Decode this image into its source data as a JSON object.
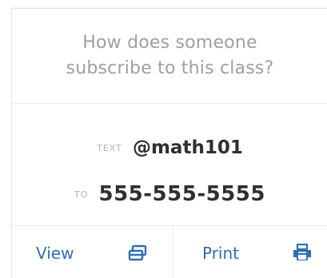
{
  "prompt": {
    "question": "How does someone subscribe to this class?"
  },
  "subscribe": {
    "text_label": "TEXT",
    "handle": "@math101",
    "to_label": "TO",
    "phone_number": "555-555-5555"
  },
  "actions": {
    "view_label": "View",
    "view_icon": "window-icon",
    "print_label": "Print",
    "print_icon": "printer-icon"
  },
  "colors": {
    "accent": "#2f6fb3",
    "muted_text": "#a0a0a0",
    "dark_text": "#2f2f2f"
  }
}
